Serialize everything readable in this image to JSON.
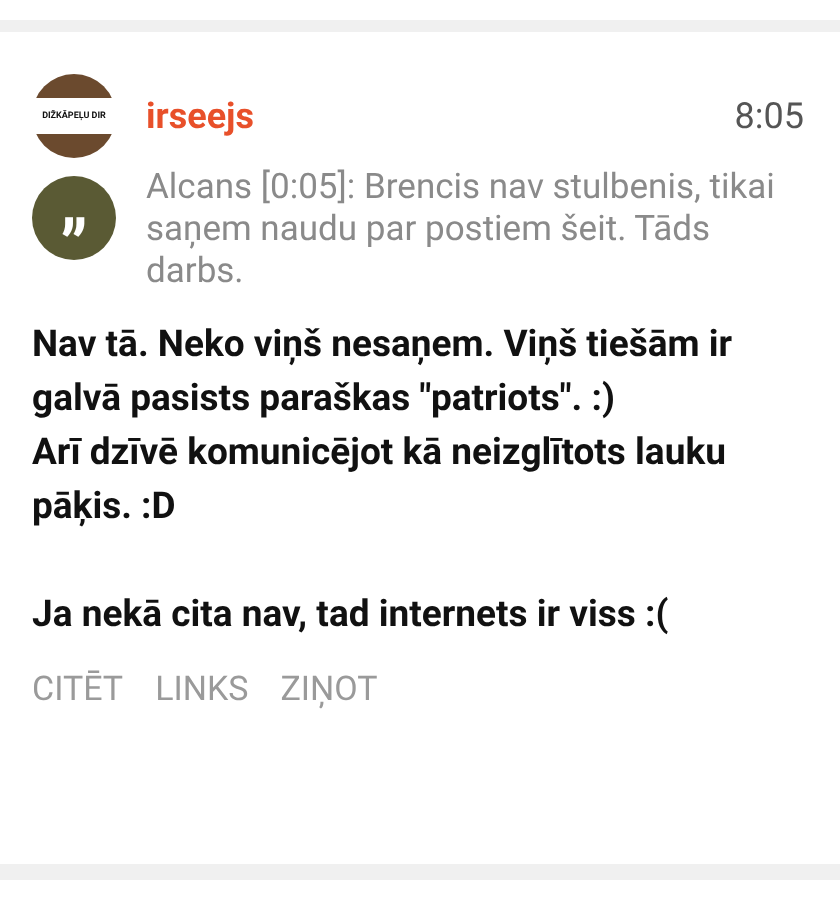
{
  "post": {
    "avatar_text": "DIŽKĀPEĻU DIR",
    "author": "irseejs",
    "time": "8:05",
    "quote": {
      "icon": "„",
      "text": "Alcans [0:05]: Brencis nav stulbenis, tikai saņem naudu par postiem šeit. Tāds darbs."
    },
    "body": "Nav tā. Neko viņš nesaņem. Viņš tiešām ir galvā pasists paraškas \"patriots\". :)\nArī dzīvē komunicējot kā neizglītots lauku pāķis. :D\n\nJa nekā cita nav, tad internets ir viss :(",
    "actions": [
      "CITĒT",
      "LINKS",
      "ZIŅOT"
    ]
  }
}
